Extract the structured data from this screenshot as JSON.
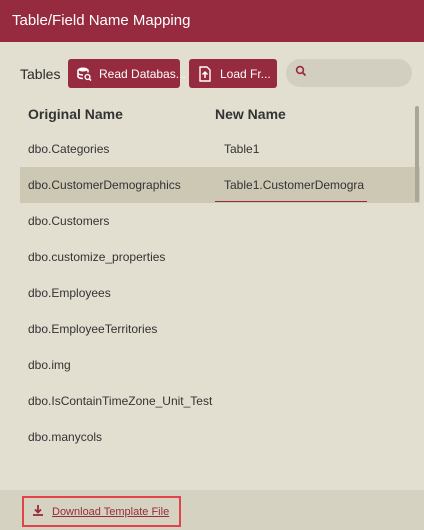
{
  "window": {
    "title": "Table/Field Name Mapping"
  },
  "toolbar": {
    "tables_label": "Tables",
    "read_database_label": "Read Databas...",
    "load_file_label": "Load Fr...",
    "search_placeholder": ""
  },
  "grid": {
    "columns": [
      "Original Name",
      "New Name"
    ],
    "rows": [
      {
        "original": "dbo.Categories",
        "new_name": "Table1"
      },
      {
        "original": "dbo.CustomerDemographics",
        "new_name": "Table1.CustomerDemogra",
        "selected": true,
        "editing": true
      },
      {
        "original": "dbo.Customers",
        "new_name": ""
      },
      {
        "original": "dbo.customize_properties",
        "new_name": ""
      },
      {
        "original": "dbo.Employees",
        "new_name": ""
      },
      {
        "original": "dbo.EmployeeTerritories",
        "new_name": ""
      },
      {
        "original": "dbo.img",
        "new_name": ""
      },
      {
        "original": "dbo.IsContainTimeZone_Unit_Test",
        "new_name": ""
      },
      {
        "original": "dbo.manycols",
        "new_name": ""
      }
    ]
  },
  "footer": {
    "download_template_label": "Download Template File"
  },
  "colors": {
    "accent": "#962a3e",
    "background": "#e2ded0",
    "selected_row": "#cdc8b3",
    "highlight_border": "#e2424a"
  },
  "icons": {
    "read_database": "database-search-icon",
    "load_file": "file-upload-icon",
    "search": "search-icon",
    "download": "download-icon"
  }
}
